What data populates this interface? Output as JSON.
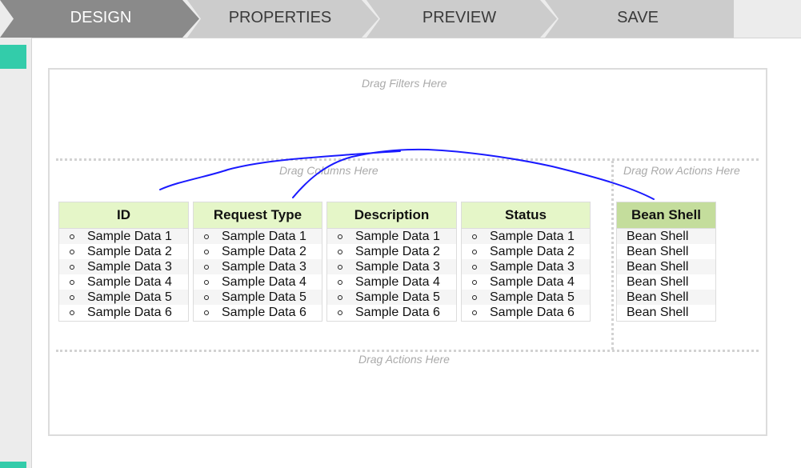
{
  "wizard": {
    "steps": [
      {
        "label": "DESIGN",
        "active": true
      },
      {
        "label": "PROPERTIES",
        "active": false
      },
      {
        "label": "PREVIEW",
        "active": false
      },
      {
        "label": "SAVE",
        "active": false
      }
    ]
  },
  "canvas": {
    "filters_hint": "Drag Filters Here",
    "columns_hint": "Drag Columns Here",
    "row_actions_hint": "Drag Row Actions Here",
    "actions_hint": "Drag Actions Here"
  },
  "columns": [
    {
      "header": "ID",
      "rows": [
        "Sample Data 1",
        "Sample Data 2",
        "Sample Data 3",
        "Sample Data 4",
        "Sample Data 5",
        "Sample Data 6"
      ]
    },
    {
      "header": "Request Type",
      "rows": [
        "Sample Data 1",
        "Sample Data 2",
        "Sample Data 3",
        "Sample Data 4",
        "Sample Data 5",
        "Sample Data 6"
      ]
    },
    {
      "header": "Description",
      "rows": [
        "Sample Data 1",
        "Sample Data 2",
        "Sample Data 3",
        "Sample Data 4",
        "Sample Data 5",
        "Sample Data 6"
      ]
    },
    {
      "header": "Status",
      "rows": [
        "Sample Data 1",
        "Sample Data 2",
        "Sample Data 3",
        "Sample Data 4",
        "Sample Data 5",
        "Sample Data 6"
      ]
    }
  ],
  "row_action": {
    "header": "Bean Shell",
    "rows": [
      "Bean Shell",
      "Bean Shell",
      "Bean Shell",
      "Bean Shell",
      "Bean Shell",
      "Bean Shell"
    ]
  },
  "colors": {
    "accent": "#33ccaa",
    "active_step": "#8a8a8a",
    "inactive_step": "#cccccc",
    "column_header": "#e5f6c8",
    "row_action_header": "#c4dd9c",
    "annotation_ink": "#1a1aff"
  },
  "annotation": {
    "type": "handwritten-arcs",
    "color": "#1a1aff"
  }
}
